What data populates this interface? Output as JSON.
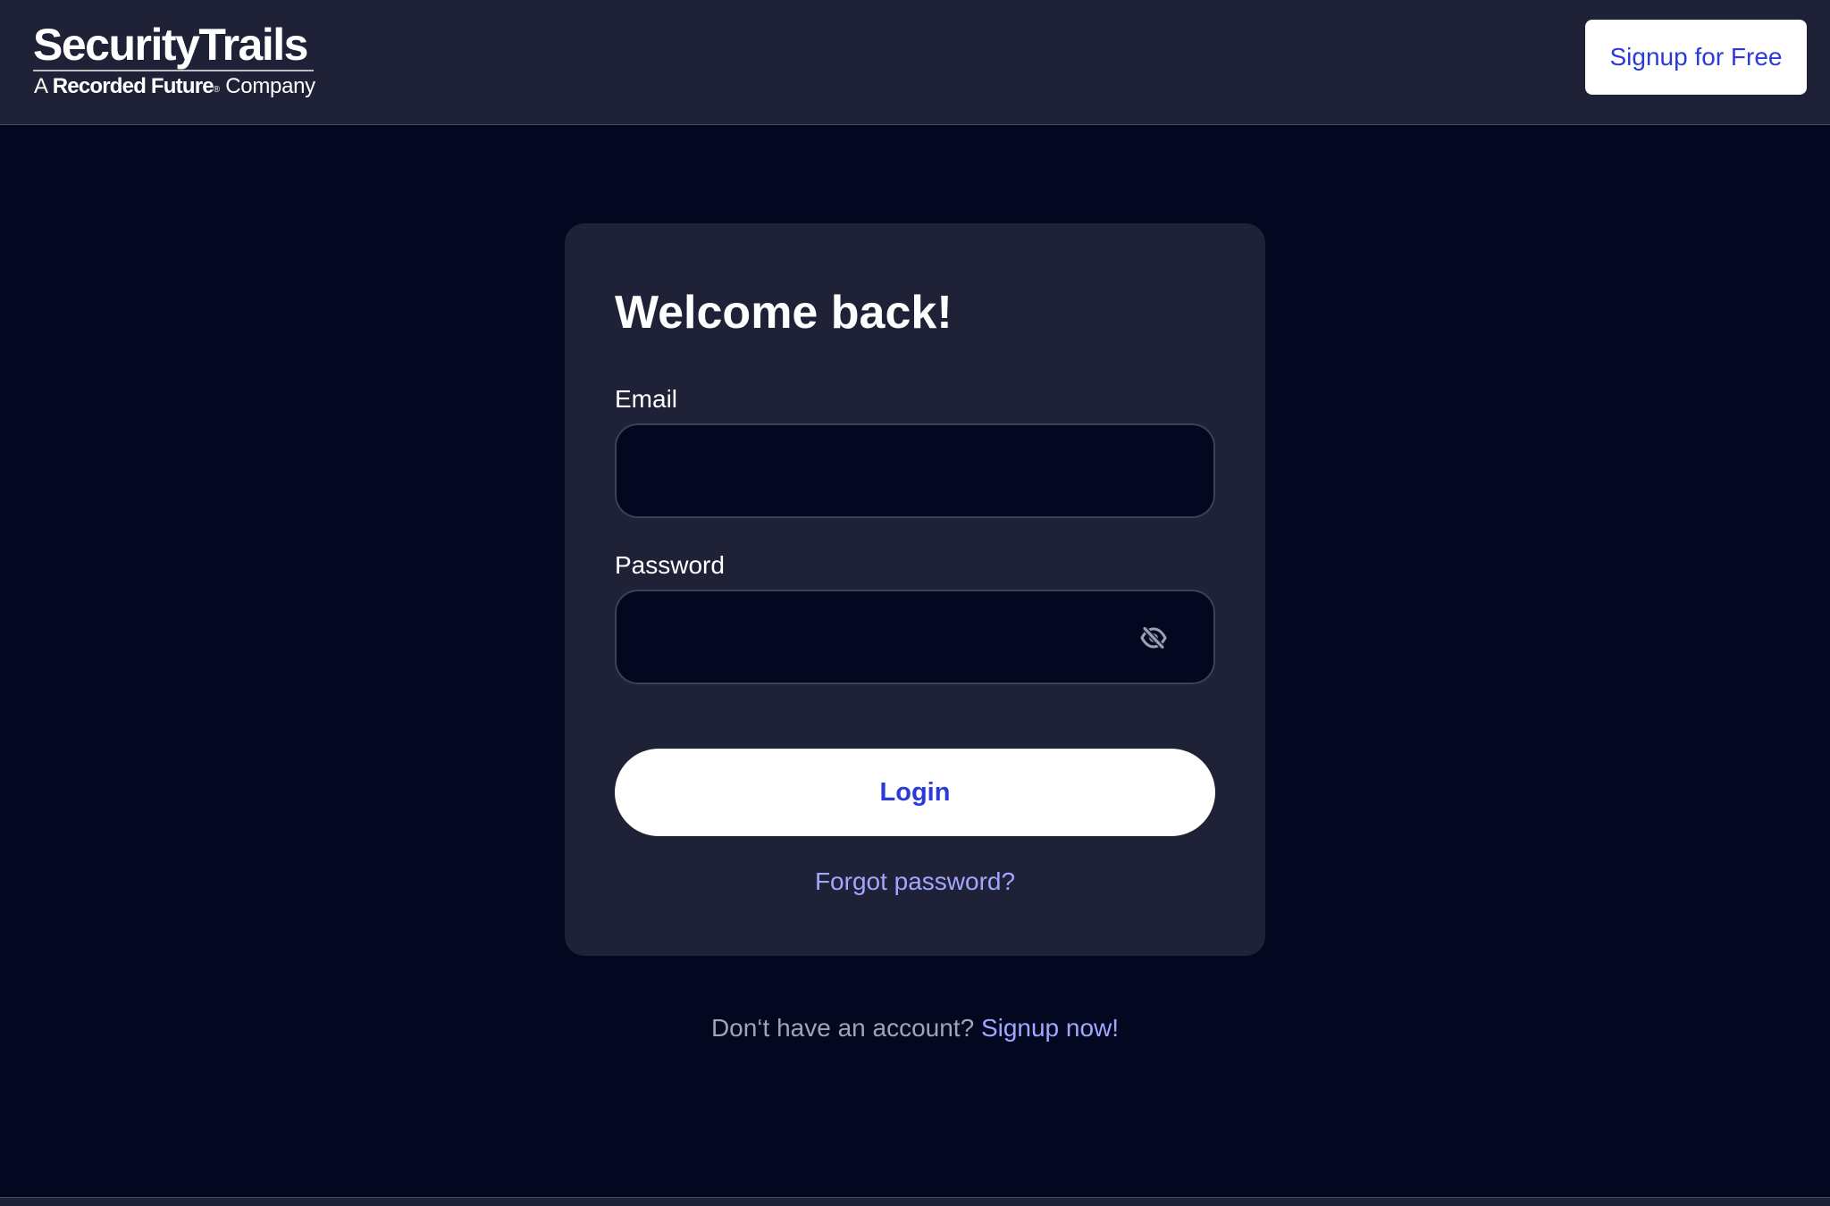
{
  "header": {
    "logo": {
      "brand": "SecurityTrails",
      "tagline_prefix": "A",
      "tagline_brand": "Recorded Future",
      "tagline_suffix": "Company"
    },
    "signup_button": "Signup for Free"
  },
  "login_card": {
    "title": "Welcome back!",
    "email": {
      "label": "Email",
      "value": "",
      "placeholder": ""
    },
    "password": {
      "label": "Password",
      "value": "",
      "placeholder": "",
      "toggle_icon": "eye-off-icon"
    },
    "login_button": "Login",
    "forgot_link": "Forgot password?"
  },
  "footer": {
    "prompt": "Don‘t have an account?",
    "signup_link": "Signup now!"
  },
  "colors": {
    "page_background": "#030720",
    "card_background": "#1f2137",
    "accent_text": "#2b3bd7",
    "link": "#a1a7ff",
    "muted_text": "#a3a4b3"
  }
}
